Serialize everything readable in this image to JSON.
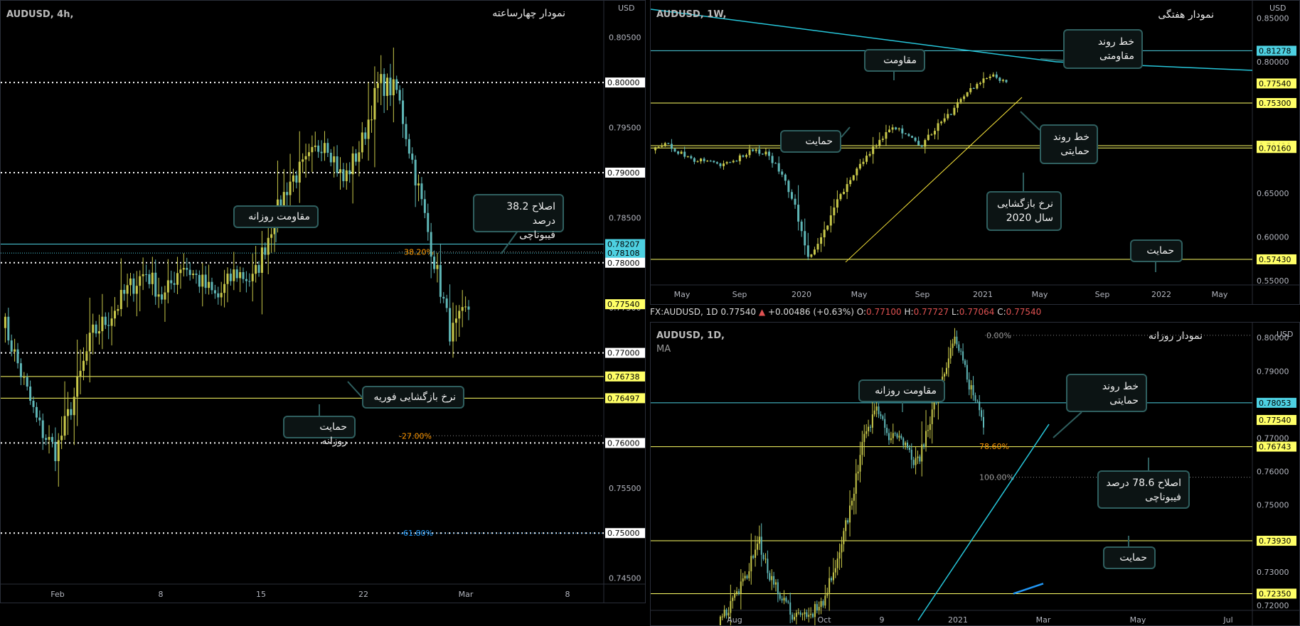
{
  "theme": {
    "bg": "#000000",
    "grid": "#2a2e39",
    "text": "#b2b5be",
    "support": "#ffff66",
    "resistance": "#4dd0e1",
    "trend_yellow": "#ffeb3b",
    "trend_cyan": "#26c6da",
    "blue": "#2196f3",
    "fib": "#ff9800"
  },
  "left": {
    "symbol": "AUDUSD, 4h,",
    "title": "نمودار چهارساعته",
    "currency": "USD",
    "price_ticks": [
      "0.80500",
      "0.80000",
      "0.79500",
      "0.79000",
      "0.78500",
      "0.78000",
      "0.77500",
      "0.77000",
      "0.76500",
      "0.76000",
      "0.75500",
      "0.75000",
      "0.74500"
    ],
    "time_ticks": [
      "Feb",
      "8",
      "15",
      "22",
      "Mar",
      "8"
    ],
    "price_tags": [
      {
        "label": "0.78207",
        "kind": "cyan"
      },
      {
        "label": "0.78108",
        "kind": "cyan"
      },
      {
        "label": "0.77540",
        "kind": "yellow"
      },
      {
        "label": "0.76738",
        "kind": "yellow"
      },
      {
        "label": "0.76497",
        "kind": "yellow"
      }
    ],
    "white_tags": [
      "0.80000",
      "0.79000",
      "0.78000",
      "0.77000",
      "0.76000",
      "0.75000"
    ],
    "fib_labels": [
      "38.20%",
      "-27.00%",
      "-61.80%"
    ],
    "boxes": {
      "daily_res": "مقاومت روزانه",
      "fib382": "اصلاح 38.2 درصد\nفیبوناچی",
      "feb_return": "نرخ بازگشایی فوریه",
      "daily_sup": "حمایت روزانه"
    }
  },
  "tr": {
    "symbol": "AUDUSD, 1W,",
    "title": "نمودار هفتگی",
    "currency": "USD",
    "price_ticks": [
      "0.85000",
      "0.80000",
      "0.75000",
      "0.70000",
      "0.65000",
      "0.60000",
      "0.55000"
    ],
    "time_ticks": [
      "May",
      "Sep",
      "2020",
      "May",
      "Sep",
      "2021",
      "May",
      "Sep",
      "2022",
      "May"
    ],
    "price_tags": [
      {
        "label": "0.81278",
        "kind": "cyan"
      },
      {
        "label": "0.77540",
        "kind": "yellow"
      },
      {
        "label": "0.75300",
        "kind": "yellow"
      },
      {
        "label": "0.70420",
        "kind": "yellow"
      },
      {
        "label": "0.70160",
        "kind": "yellow"
      },
      {
        "label": "0.57430",
        "kind": "yellow"
      }
    ],
    "boxes": {
      "trend_res": "خط روند مقاومتی",
      "res": "مقاومت",
      "sup": "حمایت",
      "trend_sup": "خط روند\nحمایتی",
      "ret2020": "نرخ بازگشایی\nسال 2020",
      "sup2": "حمایت"
    }
  },
  "ohlc": {
    "prefix": "FX:AUDUSD, 1D",
    "last": "0.77540",
    "arrow": "▲",
    "change": "+0.00486 (+0.63%)",
    "o_label": "O:",
    "o": "0.77100",
    "h_label": "H:",
    "h": "0.77727",
    "l_label": "L:",
    "l": "0.77064",
    "c_label": "C:",
    "c": "0.77540"
  },
  "br": {
    "symbol": "AUDUSD, 1D,",
    "ma": "MA",
    "title": "نمودار روزانه",
    "currency": "USD",
    "price_ticks": [
      "0.80000",
      "0.79000",
      "0.77000",
      "0.76000",
      "0.75000",
      "0.74000",
      "0.73000",
      "0.72000"
    ],
    "time_ticks": [
      "Aug",
      "Oct",
      "9",
      "2021",
      "Mar",
      "May",
      "Jul"
    ],
    "price_tags": [
      {
        "label": "0.78053",
        "kind": "cyan"
      },
      {
        "label": "0.77540",
        "kind": "yellow"
      },
      {
        "label": "0.76743",
        "kind": "yellow"
      },
      {
        "label": "0.73930",
        "kind": "yellow"
      },
      {
        "label": "0.72350",
        "kind": "yellow"
      }
    ],
    "fib_labels": [
      "0.00%",
      "78.60%",
      "100.00%"
    ],
    "boxes": {
      "daily_res": "مقاومت روزانه",
      "trend_sup": "خط روند حمایتی",
      "fib786": "اصلاح 78.6 درصد\nفیبوناچی",
      "sup": "حمایت"
    }
  },
  "chart_data": [
    {
      "type": "candlestick",
      "title": "نمودار چهارساعته",
      "symbol": "AUDUSD",
      "timeframe": "4h",
      "ylim": [
        0.7445,
        0.8075
      ],
      "last": 0.7754,
      "x_ticks": [
        "Feb",
        "8",
        "15",
        "22",
        "Mar",
        "8"
      ],
      "levels": {
        "resistance": [
          0.78207,
          0.78108
        ],
        "support": [
          0.76738,
          0.76497
        ],
        "round": [
          0.8,
          0.79,
          0.78,
          0.77,
          0.76,
          0.75
        ]
      },
      "fibonacci": {
        "38.20%": 0.7812,
        "-27.00%": 0.7608,
        "-61.80%": 0.75
      }
    },
    {
      "type": "candlestick",
      "title": "نمودار هفتگی",
      "symbol": "AUDUSD",
      "timeframe": "1W",
      "ylim": [
        0.545,
        0.87
      ],
      "last": 0.7754,
      "x_ticks": [
        "May",
        "Sep",
        "2020",
        "May",
        "Sep",
        "2021",
        "May",
        "Sep",
        "2022",
        "May"
      ],
      "levels": {
        "resistance": [
          0.81278
        ],
        "support": [
          0.7754,
          0.753,
          0.7042,
          0.7016,
          0.5743
        ]
      }
    },
    {
      "type": "candlestick",
      "title": "نمودار روزانه",
      "symbol": "AUDUSD",
      "timeframe": "1D",
      "ylim": [
        0.7185,
        0.8045
      ],
      "last": 0.7754,
      "open": 0.771,
      "high": 0.77727,
      "low": 0.77064,
      "close": 0.7754,
      "change": 0.00486,
      "change_pct": 0.63,
      "x_ticks": [
        "Aug",
        "Oct",
        "9",
        "2021",
        "Mar",
        "May",
        "Jul"
      ],
      "levels": {
        "resistance": [
          0.78053
        ],
        "support": [
          0.7754,
          0.76743,
          0.7393,
          0.7235
        ]
      },
      "fibonacci": {
        "0.00%": 0.8007,
        "78.60%": 0.7675,
        "100.00%": 0.7583
      }
    }
  ]
}
